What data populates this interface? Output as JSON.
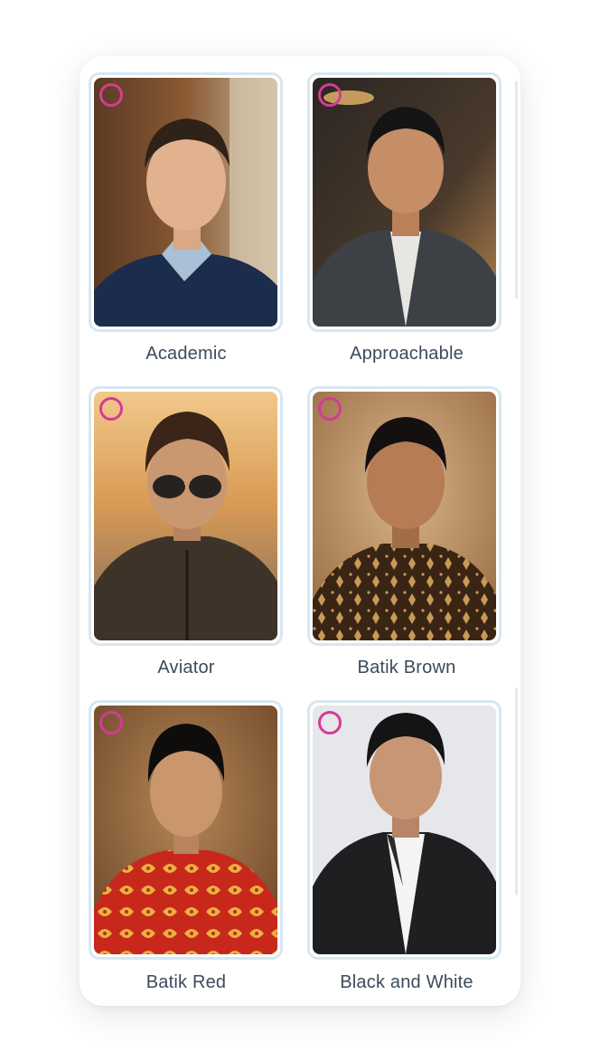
{
  "styles": [
    {
      "label": "Academic",
      "selected": false,
      "photo_icon": "portrait-academic"
    },
    {
      "label": "Approachable",
      "selected": false,
      "photo_icon": "portrait-approachable"
    },
    {
      "label": "Aviator",
      "selected": false,
      "photo_icon": "portrait-aviator"
    },
    {
      "label": "Batik Brown",
      "selected": false,
      "photo_icon": "portrait-batik-brown"
    },
    {
      "label": "Batik Red",
      "selected": false,
      "photo_icon": "portrait-batik-red"
    },
    {
      "label": "Black and White",
      "selected": false,
      "photo_icon": "portrait-black-and-white"
    }
  ],
  "colors": {
    "radio": "#d53a98",
    "card_border": "#d7e7f1",
    "label_text": "#3d4a5c"
  }
}
